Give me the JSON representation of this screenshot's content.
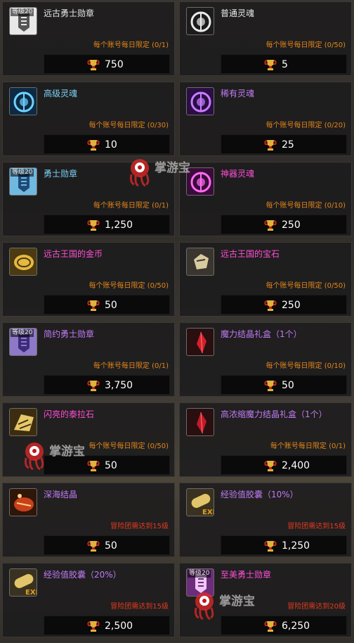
{
  "colors": {
    "white": "#e8e8e8",
    "blue": "#7bd2f5",
    "purple": "#c07cf6",
    "pink": "#ff4fd8",
    "orange": "#e2861c",
    "red": "#e33b22"
  },
  "watermark": {
    "text": "掌游宝"
  },
  "items": [
    {
      "name": "远古勇士勋章",
      "name_color": "white",
      "level": "等级20",
      "limit": "每个账号每日限定 (0/1)",
      "limit_color": "orange",
      "price": "750",
      "icon": "warrior-badge-icon"
    },
    {
      "name": "普通灵魂",
      "name_color": "white",
      "level": "",
      "limit": "每个账号每日限定 (0/50)",
      "limit_color": "orange",
      "price": "5",
      "icon": "soul-orb-icon"
    },
    {
      "name": "高级灵魂",
      "name_color": "blue",
      "level": "",
      "limit": "每个账号每日限定 (0/30)",
      "limit_color": "orange",
      "price": "10",
      "icon": "soul-orb-icon"
    },
    {
      "name": "稀有灵魂",
      "name_color": "purple",
      "level": "",
      "limit": "每个账号每日限定 (0/20)",
      "limit_color": "orange",
      "price": "25",
      "icon": "soul-orb-icon"
    },
    {
      "name": "勇士勋章",
      "name_color": "blue",
      "level": "等级20",
      "limit": "每个账号每日限定 (0/1)",
      "limit_color": "orange",
      "price": "1,250",
      "icon": "warrior-badge-icon"
    },
    {
      "name": "神器灵魂",
      "name_color": "pink",
      "level": "",
      "limit": "每个账号每日限定 (0/10)",
      "limit_color": "orange",
      "price": "250",
      "icon": "soul-orb-icon"
    },
    {
      "name": "远古王国的金币",
      "name_color": "pink",
      "level": "",
      "limit": "每个账号每日限定 (0/50)",
      "limit_color": "orange",
      "price": "50",
      "icon": "gold-coin-icon"
    },
    {
      "name": "远古王国的宝石",
      "name_color": "pink",
      "level": "",
      "limit": "每个账号每日限定 (0/50)",
      "limit_color": "orange",
      "price": "250",
      "icon": "gem-stone-icon"
    },
    {
      "name": "简约勇士勋章",
      "name_color": "purple",
      "level": "等级20",
      "limit": "每个账号每日限定 (0/1)",
      "limit_color": "orange",
      "price": "3,750",
      "icon": "warrior-badge-icon"
    },
    {
      "name": "魔力结晶礼盒（1个）",
      "name_color": "purple",
      "level": "",
      "limit": "每个账号每日限定 (0/10)",
      "limit_color": "orange",
      "price": "50",
      "icon": "red-crystal-icon"
    },
    {
      "name": "闪亮的泰拉石",
      "name_color": "pink",
      "level": "",
      "limit": "每个账号每日限定 (0/50)",
      "limit_color": "orange",
      "price": "50",
      "icon": "tera-stone-icon"
    },
    {
      "name": "高浓缩魔力结晶礼盒（1个）",
      "name_color": "purple",
      "level": "",
      "limit": "每个账号每日限定 (0/1)",
      "limit_color": "orange",
      "price": "2,400",
      "icon": "red-crystal-icon"
    },
    {
      "name": "深海结晶",
      "name_color": "purple",
      "level": "",
      "limit": "冒险团需达到15级",
      "limit_color": "red",
      "price": "50",
      "icon": "deep-sea-crystal-icon"
    },
    {
      "name": "经验值胶囊（10%）",
      "name_color": "purple",
      "level": "",
      "limit": "冒险团需达到15级",
      "limit_color": "red",
      "price": "1,250",
      "icon": "exp-capsule-icon"
    },
    {
      "name": "经验值胶囊（20%）",
      "name_color": "purple",
      "level": "",
      "limit": "冒险团需达到15级",
      "limit_color": "red",
      "price": "2,500",
      "icon": "exp-capsule-icon"
    },
    {
      "name": "至美勇士勋章",
      "name_color": "pink",
      "level": "等级20",
      "limit": "冒险团需达到20级",
      "limit_color": "red",
      "price": "6,250",
      "icon": "warrior-badge-icon"
    }
  ],
  "icon_styles": [
    {
      "bg": "#e8e8e8",
      "fg": "#555"
    },
    {
      "bg": "#1c1c1c",
      "fg": "#eaeaea"
    },
    {
      "bg": "#0d2a44",
      "fg": "#6fd2ff"
    },
    {
      "bg": "#2a0e44",
      "fg": "#c77dff"
    },
    {
      "bg": "#6fb9e0",
      "fg": "#1f4a78"
    },
    {
      "bg": "#3a0c3a",
      "fg": "#ff6cf0"
    },
    {
      "bg": "#4b3a12",
      "fg": "#e5b940"
    },
    {
      "bg": "#3b3530",
      "fg": "#d9cba0"
    },
    {
      "bg": "#8e79c8",
      "fg": "#3e2b7a"
    },
    {
      "bg": "#2a0f10",
      "fg": "#d41f2b"
    },
    {
      "bg": "#3d2d10",
      "fg": "#e6c86a"
    },
    {
      "bg": "#2a0f10",
      "fg": "#c4192a"
    },
    {
      "bg": "#2e1608",
      "fg": "#c8401b"
    },
    {
      "bg": "#3a3220",
      "fg": "#e2c56b"
    },
    {
      "bg": "#3a3220",
      "fg": "#e2c56b"
    },
    {
      "bg": "#6b2d7c",
      "fg": "#f2c8f6"
    }
  ]
}
